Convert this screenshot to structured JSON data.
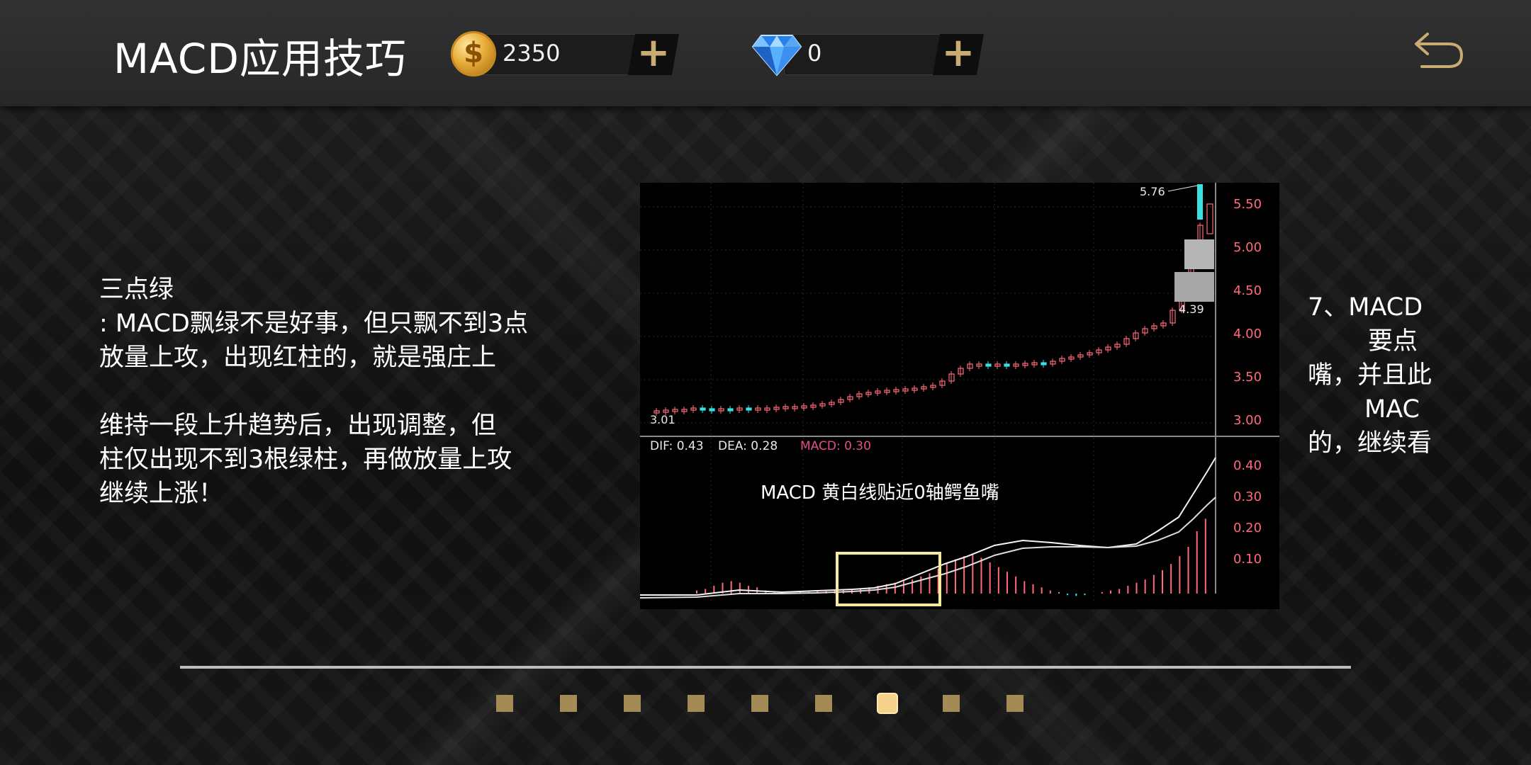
{
  "header": {
    "title": "MACD应用技巧",
    "coins": {
      "value": "2350",
      "plus_label": "+"
    },
    "gems": {
      "value": "0",
      "plus_label": "+"
    },
    "back_icon": "back-arrow-icon"
  },
  "colors": {
    "accent_gold": "#c8ac74",
    "dot_inactive": "#a48a55",
    "dot_active": "#f6d38b",
    "candle_up": "#ff6b7a",
    "candle_down": "#38e0e0",
    "macd_highlight_box": "#f4eb9c"
  },
  "slides": {
    "left": {
      "lines": [
        "三点绿",
        ": MACD飘绿不是好事，但只飘不到3点",
        "放量上攻，出现红柱的，就是强庄上",
        "",
        "维持一段上升趋势后，出现调整，但",
        "柱仅出现不到3根绿柱，再做放量上攻",
        "继续上涨！"
      ]
    },
    "right": {
      "lines": [
        "7、MACD",
        "  要点",
        "嘴，并且此",
        "  MAC",
        "的，继续看"
      ]
    },
    "chart": {
      "price_high_label": "5.76",
      "price_low_label": "3.01",
      "box_value_label": "4.39",
      "price_ticks": [
        "5.50",
        "5.00",
        "4.50",
        "4.00",
        "3.50",
        "3.00"
      ],
      "macd_ticks": [
        "0.40",
        "0.30",
        "0.20",
        "0.10"
      ],
      "dif_label": "DIF: 0.43",
      "dea_label": "DEA: 0.28",
      "macd_label": "MACD: 0.30",
      "annotation": "MACD  黄白线贴近0轴鳄鱼嘴"
    }
  },
  "pager": {
    "total": 9,
    "active_index": 6
  }
}
